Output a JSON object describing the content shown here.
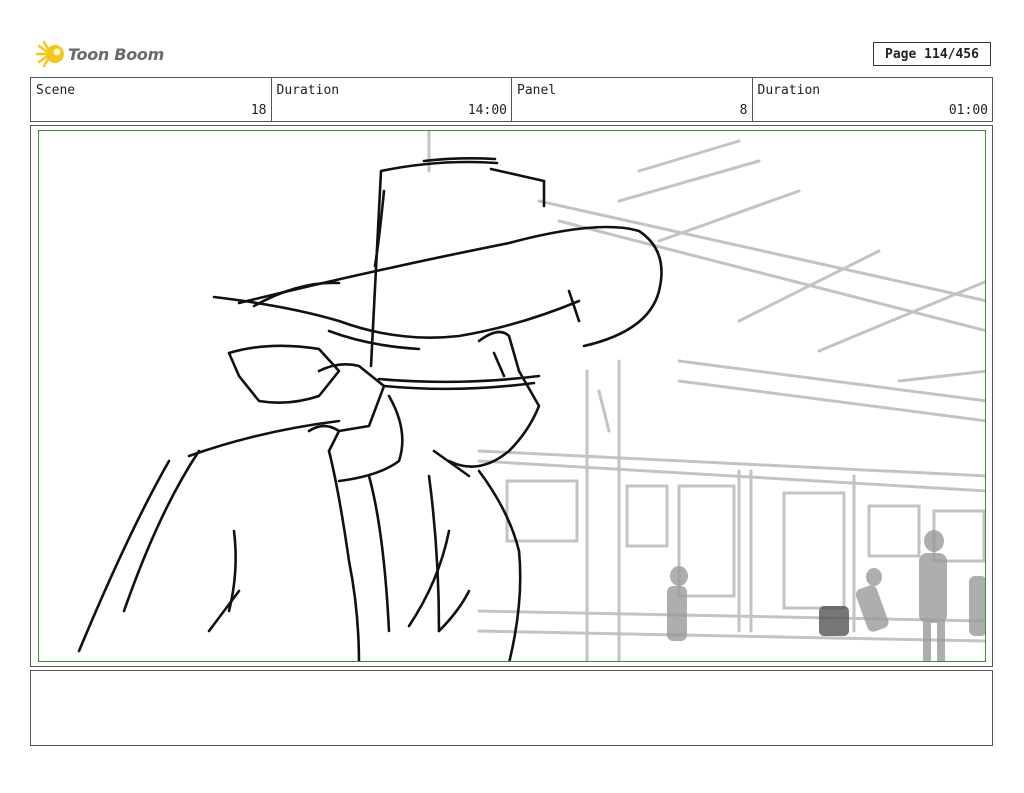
{
  "brand": {
    "name": "Toon Boom",
    "logo_icon": "toon-boom-starburst-icon",
    "accent": "#f5c518"
  },
  "page": {
    "label": "Page 114/456"
  },
  "info": {
    "scene_label": "Scene",
    "scene_value": "18",
    "scene_duration_label": "Duration",
    "scene_duration_value": "14:00",
    "panel_label": "Panel",
    "panel_value": "8",
    "panel_duration_label": "Duration",
    "panel_duration_value": "01:00"
  },
  "panel_image": {
    "description_icon": "storyboard-sketch-image",
    "frame_color": "#3f8a3f"
  },
  "notes": {
    "text": ""
  }
}
